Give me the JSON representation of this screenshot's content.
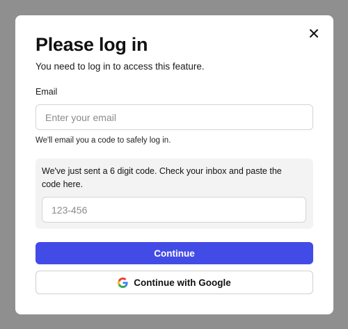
{
  "modal": {
    "title": "Please log in",
    "subtitle": "You need to log in to access this feature.",
    "close_icon": "close-icon"
  },
  "email": {
    "label": "Email",
    "value": "",
    "placeholder": "Enter your email",
    "hint": "We'll email you a code to safely log in."
  },
  "code": {
    "message": "We've just sent a 6 digit code. Check your inbox and paste the code here.",
    "value": "",
    "placeholder": "123-456"
  },
  "actions": {
    "continue_label": "Continue",
    "google_label": "Continue with Google",
    "google_icon": "google-icon"
  },
  "colors": {
    "overlay": "#8f8f8f",
    "primary": "#434be6",
    "panel": "#f3f3f3"
  }
}
